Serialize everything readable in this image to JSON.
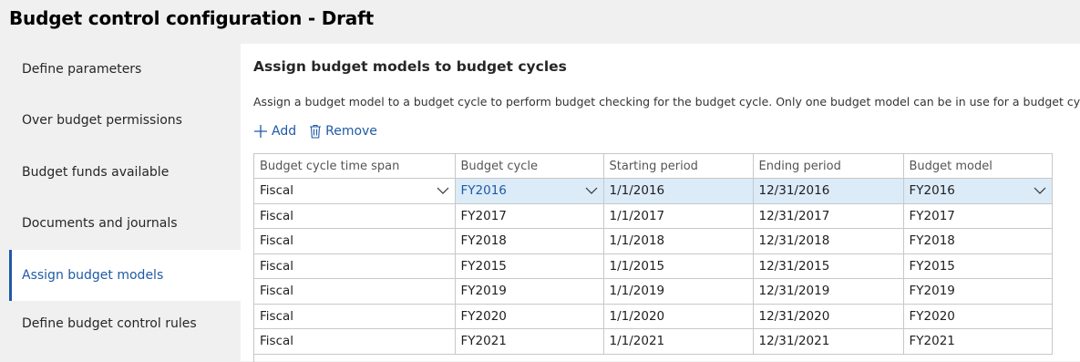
{
  "title": "Budget control configuration - Draft",
  "sidebar": {
    "items": [
      {
        "label": "Define parameters"
      },
      {
        "label": "Over budget permissions"
      },
      {
        "label": "Budget funds available"
      },
      {
        "label": "Documents and journals"
      },
      {
        "label": "Assign budget models"
      },
      {
        "label": "Define budget control rules"
      }
    ],
    "active": "Assign budget models"
  },
  "main": {
    "section_title": "Assign budget models to budget cycles",
    "description": "Assign a budget model to a budget cycle to perform budget checking for the budget cycle. Only one budget model can be in use for a budget cycle.",
    "toolbar": {
      "add_label": "Add",
      "remove_label": "Remove"
    },
    "grid": {
      "columns": [
        "Budget cycle time span",
        "Budget cycle",
        "Starting period",
        "Ending period",
        "Budget model"
      ],
      "rows": [
        [
          "Fiscal",
          "FY2016",
          "1/1/2016",
          "12/31/2016",
          "FY2016"
        ],
        [
          "Fiscal",
          "FY2017",
          "1/1/2017",
          "12/31/2017",
          "FY2017"
        ],
        [
          "Fiscal",
          "FY2018",
          "1/1/2018",
          "12/31/2018",
          "FY2018"
        ],
        [
          "Fiscal",
          "FY2015",
          "1/1/2015",
          "12/31/2015",
          "FY2015"
        ],
        [
          "Fiscal",
          "FY2019",
          "1/1/2019",
          "12/31/2019",
          "FY2019"
        ],
        [
          "Fiscal",
          "FY2020",
          "1/1/2020",
          "12/31/2020",
          "FY2020"
        ],
        [
          "Fiscal",
          "FY2021",
          "1/1/2021",
          "12/31/2021",
          "FY2021"
        ]
      ],
      "selected_row": 0
    }
  },
  "colors": {
    "accent": "#1f5aa6",
    "selected_row": "#dcebf8",
    "sidebar_bg": "#f0f0f0"
  }
}
